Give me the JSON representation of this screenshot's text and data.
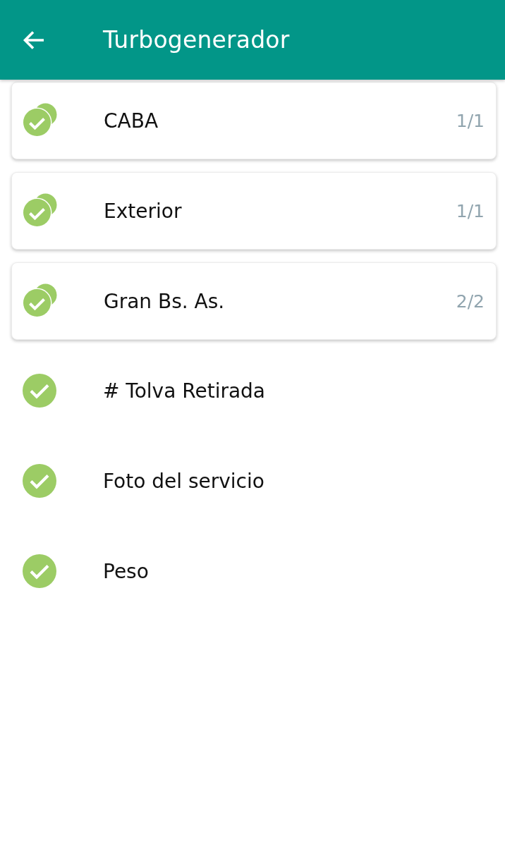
{
  "app_bar": {
    "title": "Turbogenerador"
  },
  "items": [
    {
      "kind": "group",
      "label": "CABA",
      "count": "1/1",
      "completed": true
    },
    {
      "kind": "group",
      "label": "Exterior",
      "count": "1/1",
      "completed": true
    },
    {
      "kind": "group",
      "label": "Gran Bs. As.",
      "count": "2/2",
      "completed": true
    },
    {
      "kind": "field",
      "label": "# Tolva Retirada",
      "completed": true
    },
    {
      "kind": "field",
      "label": "Foto del servicio",
      "completed": true
    },
    {
      "kind": "field",
      "label": "Peso",
      "completed": true
    }
  ]
}
